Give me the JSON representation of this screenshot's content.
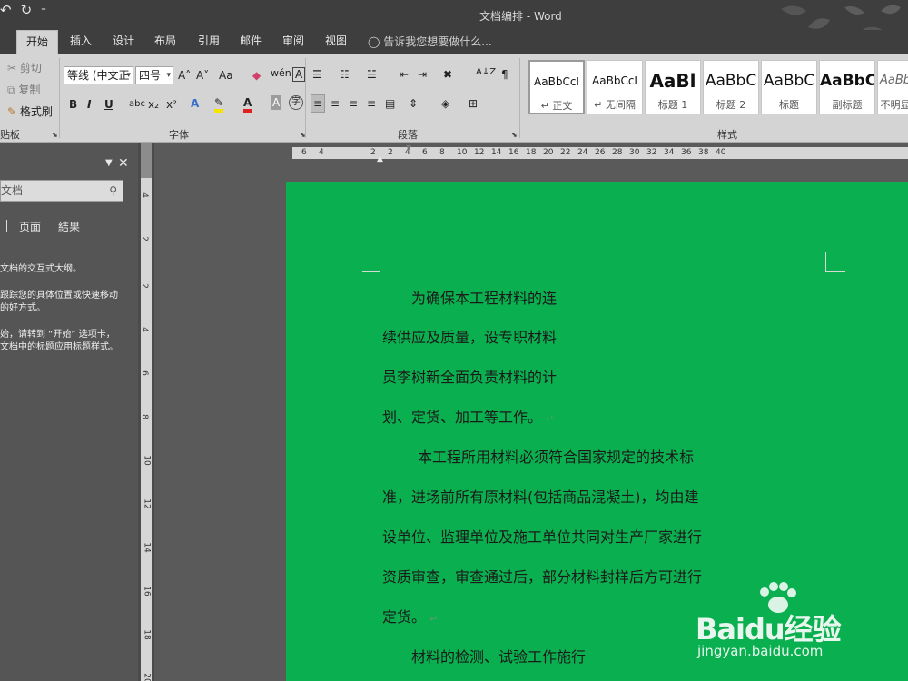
{
  "titlebar": {
    "title": "文档编排 - Word",
    "qat": [
      "↶",
      "↻",
      "⁼"
    ]
  },
  "tabs": [
    "开始",
    "插入",
    "设计",
    "布局",
    "引用",
    "邮件",
    "审阅",
    "视图"
  ],
  "tell_me": "告诉我您想要做什么...",
  "clipboard": {
    "cut": "剪切",
    "copy": "复制",
    "format_painter": "格式刷",
    "label": "贴板"
  },
  "font": {
    "name": "等线 (中文正",
    "size": "四号",
    "grow": "A˄",
    "shrink": "A˅",
    "case": "Aa",
    "wen": "wén",
    "bold": "B",
    "italic": "I",
    "underline": "U",
    "strike": "abc",
    "sub": "x₂",
    "sup": "x²",
    "label": "字体"
  },
  "paragraph": {
    "label": "段落",
    "sort": "A↓Z"
  },
  "styles": {
    "label": "样式",
    "items": [
      {
        "preview": "AaBbCcI",
        "name": "↵ 正文"
      },
      {
        "preview": "AaBbCcI",
        "name": "↵ 无间隔"
      },
      {
        "preview": "AaBl",
        "name": "标题 1"
      },
      {
        "preview": "AaBbC",
        "name": "标题 2"
      },
      {
        "preview": "AaBbC",
        "name": "标题"
      },
      {
        "preview": "AaBbC",
        "name": "副标题"
      },
      {
        "preview": "AaBb",
        "name": "不明显"
      }
    ]
  },
  "nav_pane": {
    "search_placeholder": "文档",
    "tabs": [
      "页面",
      "結果"
    ],
    "lines": [
      "文档的交互式大纲。",
      "跟踪您的具体位置或快速移动",
      "的好方式。",
      "始，请转到 “开始” 选项卡，",
      "文档中的标题应用标题样式。"
    ]
  },
  "ruler": {
    "h_ticks": [
      "6",
      "4",
      "2",
      "2",
      "4",
      "6",
      "8",
      "10",
      "12",
      "14",
      "16",
      "18",
      "20",
      "22",
      "24",
      "26",
      "28",
      "30",
      "32",
      "34",
      "36",
      "38",
      "40"
    ],
    "v_ticks": [
      "4",
      "2",
      "2",
      "4",
      "6",
      "8",
      "10",
      "12",
      "14",
      "16",
      "18",
      "20"
    ]
  },
  "document": {
    "lines": [
      "为确保本工程材料的连",
      "续供应及质量，设专职材料",
      "员李树新全面负责材料的计",
      "划、定货、加工等工作。",
      "本工程所用材料必须符合国家规定的技术标",
      "准，进场前所有原材料(包括商品混凝土)，均由建",
      "设单位、监理单位及施工单位共同对生产厂家进行",
      "资质审查，审查通过后，部分材料封样后方可进行",
      "定货。",
      "材料的检测、试验工作施行"
    ]
  },
  "watermark": {
    "brand": "Baidu经验",
    "url": "jingyan.baidu.com"
  },
  "colors": {
    "page": "#0aaf4f",
    "ribbon": "#d4d4d4",
    "dark_bar": "#3e3e3e"
  }
}
